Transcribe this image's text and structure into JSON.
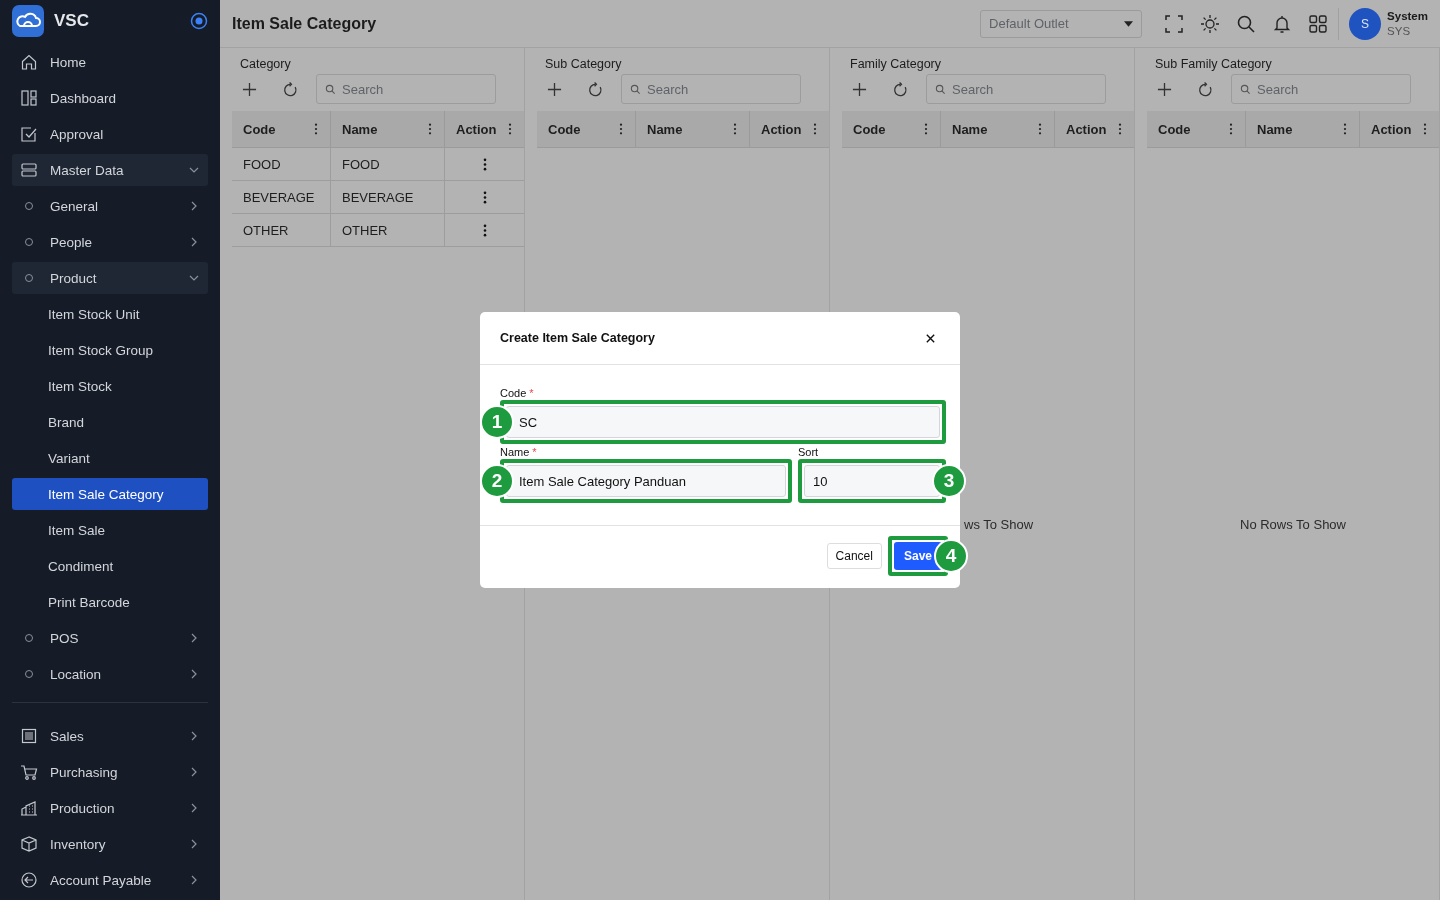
{
  "sidebar": {
    "brand": "VSC",
    "items": [
      {
        "label": "Home",
        "selected": false
      },
      {
        "label": "Dashboard",
        "selected": false
      },
      {
        "label": "Approval",
        "selected": false
      },
      {
        "label": "Master Data",
        "selected": false,
        "expanded": true,
        "children": [
          {
            "label": "General",
            "selected": false,
            "expanded": false
          },
          {
            "label": "People",
            "selected": false,
            "expanded": false
          },
          {
            "label": "Product",
            "selected": false,
            "expanded": true,
            "children": [
              {
                "label": "Item Stock Unit",
                "selected": false
              },
              {
                "label": "Item Stock Group",
                "selected": false
              },
              {
                "label": "Item Stock",
                "selected": false
              },
              {
                "label": "Brand",
                "selected": false
              },
              {
                "label": "Variant",
                "selected": false
              },
              {
                "label": "Item Sale Category",
                "selected": true
              },
              {
                "label": "Item Sale",
                "selected": false
              },
              {
                "label": "Condiment",
                "selected": false
              },
              {
                "label": "Print Barcode",
                "selected": false
              }
            ]
          },
          {
            "label": "POS",
            "selected": false,
            "expanded": false
          },
          {
            "label": "Location",
            "selected": false,
            "expanded": false
          }
        ]
      }
    ],
    "modules": [
      {
        "label": "Sales",
        "selected": false,
        "expanded": false
      },
      {
        "label": "Purchasing",
        "selected": false,
        "expanded": false
      },
      {
        "label": "Production",
        "selected": false,
        "expanded": false
      },
      {
        "label": "Inventory",
        "selected": false,
        "expanded": false
      },
      {
        "label": "Account Payable",
        "selected": false,
        "expanded": false
      }
    ]
  },
  "header": {
    "title": "Item Sale Category",
    "outlet_placeholder": "Default Outlet",
    "user": {
      "initial": "S",
      "name": "System",
      "code": "SYS"
    }
  },
  "panels": [
    {
      "title": "Category",
      "search_placeholder": "Search",
      "columns": [
        "Code",
        "Name",
        "Action"
      ],
      "rows": [
        {
          "code": "FOOD",
          "name": "FOOD"
        },
        {
          "code": "BEVERAGE",
          "name": "BEVERAGE"
        },
        {
          "code": "OTHER",
          "name": "OTHER"
        }
      ]
    },
    {
      "title": "Sub Category",
      "search_placeholder": "Search",
      "columns": [
        "Code",
        "Name",
        "Action"
      ]
    },
    {
      "title": "Family Category",
      "search_placeholder": "Search",
      "columns": [
        "Code",
        "Name",
        "Action"
      ],
      "empty_text": "ws To Show"
    },
    {
      "title": "Sub Family Category",
      "search_placeholder": "Search",
      "columns": [
        "Code",
        "Name",
        "Action"
      ],
      "empty_text": "No Rows To Show"
    }
  ],
  "modal": {
    "title": "Create Item Sale Category",
    "fields": [
      {
        "label": "Code",
        "required_mark": "*",
        "value": "SC",
        "marker": "1"
      },
      {
        "label": "Name",
        "required_mark": "*",
        "value": "Item Sale Category Panduan",
        "marker": "2"
      },
      {
        "label": "Sort",
        "value": "10",
        "marker": "3"
      }
    ],
    "cancel": "Cancel",
    "save": "Save",
    "save_marker": "4"
  }
}
